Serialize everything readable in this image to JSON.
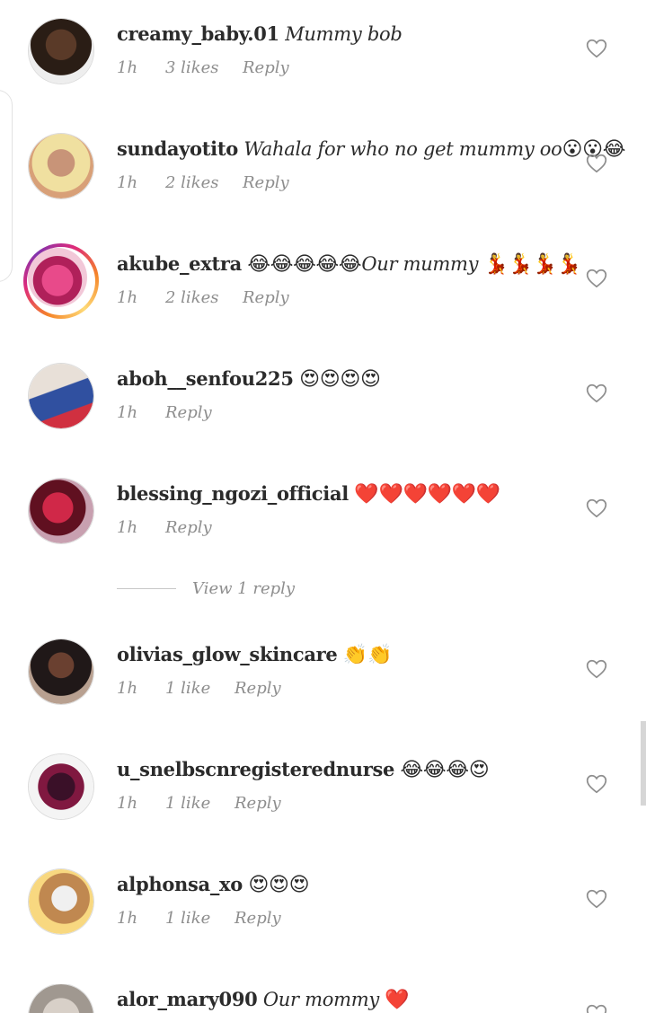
{
  "comments": [
    {
      "username": "creamy_baby.01",
      "text": "Mummy bob",
      "emoji": "",
      "time": "1h",
      "likes": "3 likes",
      "reply": "Reply"
    },
    {
      "username": "sundayotito",
      "text": "Wahala for who no get mummy oo",
      "emoji": "😮😮😂",
      "time": "1h",
      "likes": "2 likes",
      "reply": "Reply"
    },
    {
      "username": "akube_extra",
      "text_pre_emoji": "😂😂😂😂😂",
      "text": "Our mummy ",
      "emoji": "💃💃💃💃",
      "time": "1h",
      "likes": "2 likes",
      "reply": "Reply"
    },
    {
      "username": "aboh__senfou225",
      "text": "",
      "emoji": "😍😍😍😍",
      "time": "1h",
      "likes": "",
      "reply": "Reply"
    },
    {
      "username": "blessing_ngozi_official",
      "text": "",
      "emoji": "❤️❤️❤️❤️❤️❤️",
      "time": "1h",
      "likes": "",
      "reply": "Reply"
    },
    {
      "username": "olivias_glow_skincare",
      "text": "",
      "emoji": "👏👏",
      "time": "1h",
      "likes": "1 like",
      "reply": "Reply"
    },
    {
      "username": "u_snelbscnregisterednurse",
      "text": "",
      "emoji": "😂😂😂😍",
      "time": "1h",
      "likes": "1 like",
      "reply": "Reply"
    },
    {
      "username": "alphonsa_xo",
      "text": "",
      "emoji": "😍😍😍",
      "time": "1h",
      "likes": "1 like",
      "reply": "Reply"
    },
    {
      "username": "alor_mary090",
      "text": "Our mommy",
      "emoji": "❤️",
      "time": "",
      "likes": "",
      "reply": ""
    }
  ],
  "view_replies": "View 1 reply",
  "icons": {
    "like": "heart-outline-icon"
  },
  "colors": {
    "meta": "#8e8e8e",
    "username": "#262626"
  }
}
